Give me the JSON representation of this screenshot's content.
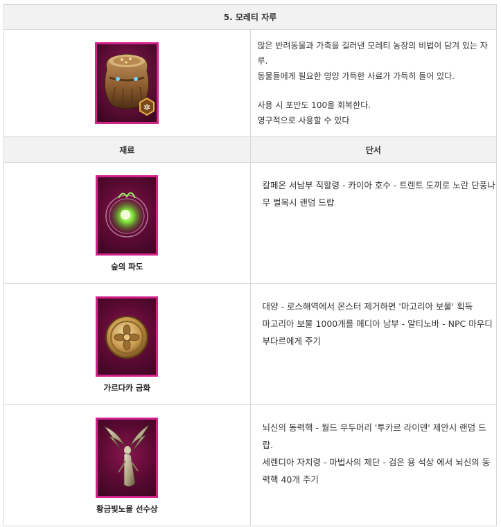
{
  "title": "5. 모레티 자루",
  "item": {
    "icon": "feed-sack-icon",
    "desc_lines": [
      "많은 반려동물과 가축을 길러낸 모레티 농장의 비법이 담겨 있는 자루.",
      "동물들에게 필요한 영양 가득한 사료가 가득히 들어 있다."
    ],
    "effect_lines": [
      "사용 시 포만도 100을 회복한다.",
      "영구적으로 사용할 수 있다"
    ]
  },
  "headers": {
    "material": "재료",
    "clue": "단서"
  },
  "materials": [
    {
      "name": "숲의 파도",
      "icon": "green-orb-icon",
      "clues": [
        "칼페온 서남부 직할령 - 카이아 호수 - 트렌트 도끼로 노란 단풍나무 벌목시 랜덤 드랍"
      ]
    },
    {
      "name": "가르다카 금화",
      "icon": "gold-coin-icon",
      "clues": [
        "대양 - 로스해역에서 몬스터 제거하면 '마고리아 보물' 획득",
        "마고리아 보물 1000개를 메디아 남부 - 알티노바 - NPC 마우디 부다르에게 주기"
      ]
    },
    {
      "name": "황금빛노을 선수상",
      "icon": "winged-figurehead-icon",
      "clues": [
        "뇌신의 동력핵 - 월드 우두머리 '투카르 라이덴' 제안시 랜덤 드랍.",
        "세렌디아 자치령 - 마법사의 제단 - 검은 용 석상 에서 뇌신의 동력핵 40개 주기"
      ]
    }
  ],
  "colors": {
    "frame": "#d2238d",
    "header_bg": "#f2f2f2",
    "border": "#d8d8d8"
  }
}
